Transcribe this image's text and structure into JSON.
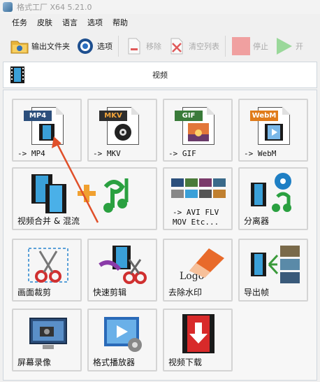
{
  "window": {
    "title": "格式工厂 X64 5.21.0"
  },
  "menu": [
    "任务",
    "皮肤",
    "语言",
    "选项",
    "帮助"
  ],
  "toolbar": {
    "output_folder": "输出文件夹",
    "options": "选项",
    "remove": "移除",
    "clear_list": "清空列表",
    "stop": "停止",
    "start": "开"
  },
  "category": {
    "label": "视频"
  },
  "tiles": {
    "mp4": {
      "tag": "MP4",
      "label": "-> MP4"
    },
    "mkv": {
      "tag": "MKV",
      "label": "-> MKV"
    },
    "gif": {
      "tag": "GIF",
      "label": "-> GIF"
    },
    "webm": {
      "tag": "WebM",
      "label": "-> WebM"
    },
    "merge": {
      "label": "视频合并 & 混流"
    },
    "avi": {
      "line1": "-> AVI FLV",
      "line2": "MOV Etc..."
    },
    "separator": {
      "label": "分离器"
    },
    "crop": {
      "label": "画面裁剪"
    },
    "quick_cut": {
      "label": "快速剪辑"
    },
    "watermark": {
      "label": "去除水印",
      "logo": "Logo"
    },
    "export_frames": {
      "label": "导出帧"
    },
    "screen_record": {
      "label": "屏幕录像"
    },
    "player": {
      "label": "格式播放器"
    },
    "download": {
      "label": "视频下载"
    }
  },
  "colors": {
    "mp4_tag": "#2c4f7c",
    "mkv_tag": "#2e2e2e",
    "gif_tag": "#3a7b3a",
    "webm_tag": "#e07b1a",
    "stop": "#f0a0a0",
    "start": "#9ad89a",
    "arrow": "#e0502a"
  }
}
